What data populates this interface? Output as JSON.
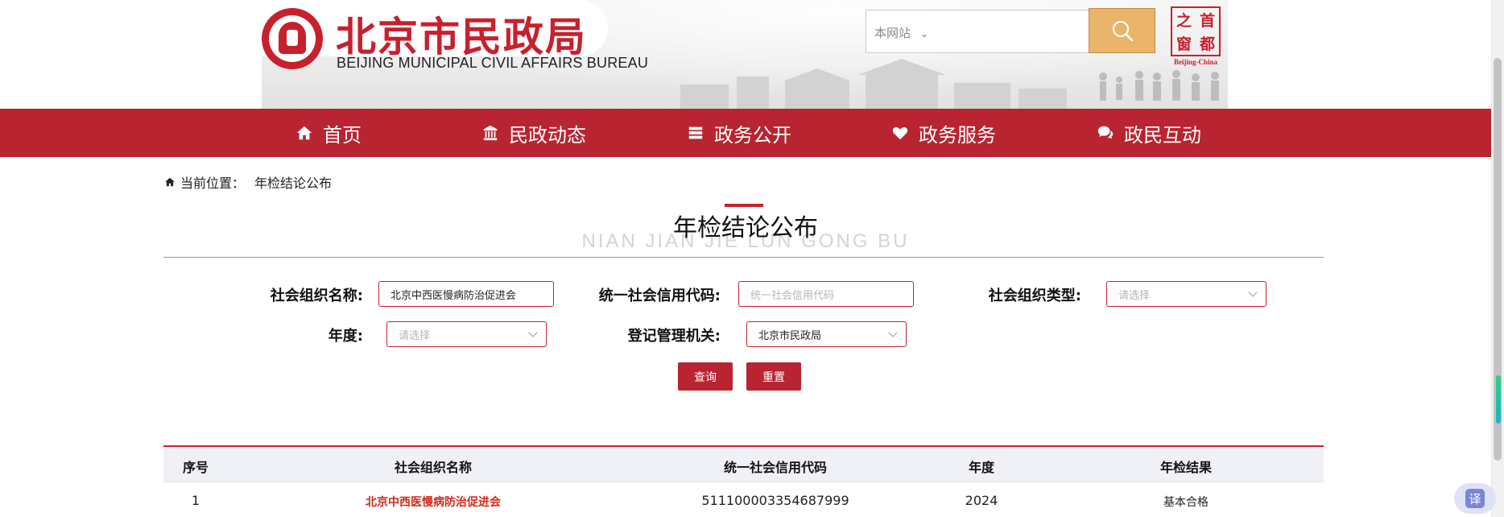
{
  "header": {
    "site_title_cn": "北京市民政局",
    "site_title_en": "BEIJING MUNICIPAL CIVIL AFFAIRS BUREAU",
    "search": {
      "scope_label": "本网站",
      "query": ""
    },
    "capital_badge": {
      "chars": [
        "之",
        "首",
        "窗",
        "都"
      ],
      "en": "Beijing-China"
    }
  },
  "nav": {
    "items": [
      {
        "label": "首页",
        "icon": "home-icon"
      },
      {
        "label": "民政动态",
        "icon": "building-icon"
      },
      {
        "label": "政务公开",
        "icon": "list-icon"
      },
      {
        "label": "政务服务",
        "icon": "heart-icon"
      },
      {
        "label": "政民互动",
        "icon": "chat-icon"
      }
    ]
  },
  "breadcrumb": {
    "prefix": "当前位置：",
    "current": "年检结论公布"
  },
  "section": {
    "title": "年检结论公布",
    "pinyin": "NIAN JIAN JIE LUN GONG BU"
  },
  "filters": {
    "org_name": {
      "label": "社会组织名称:",
      "value": "北京中西医慢病防治促进会"
    },
    "credit_code": {
      "label": "统一社会信用代码:",
      "placeholder": "统一社会信用代码"
    },
    "org_type": {
      "label": "社会组织类型:",
      "placeholder": "请选择"
    },
    "year": {
      "label": "年度:",
      "placeholder": "请选择"
    },
    "authority": {
      "label": "登记管理机关:",
      "value": "北京市民政局"
    },
    "query_label": "查询",
    "reset_label": "重置"
  },
  "table": {
    "headers": [
      "序号",
      "社会组织名称",
      "统一社会信用代码",
      "年度",
      "年检结果"
    ],
    "rows": [
      {
        "index": "1",
        "org_name": "北京中西医慢病防治促进会",
        "credit_code": "511100003354687999",
        "year": "2024",
        "result": "基本合格"
      }
    ]
  },
  "widgets": {
    "translate_label": "译"
  },
  "colors": {
    "brand_red": "#b82430",
    "title_red": "#c8202d",
    "search_gold": "#eab46a",
    "link_red": "#d6281c"
  }
}
